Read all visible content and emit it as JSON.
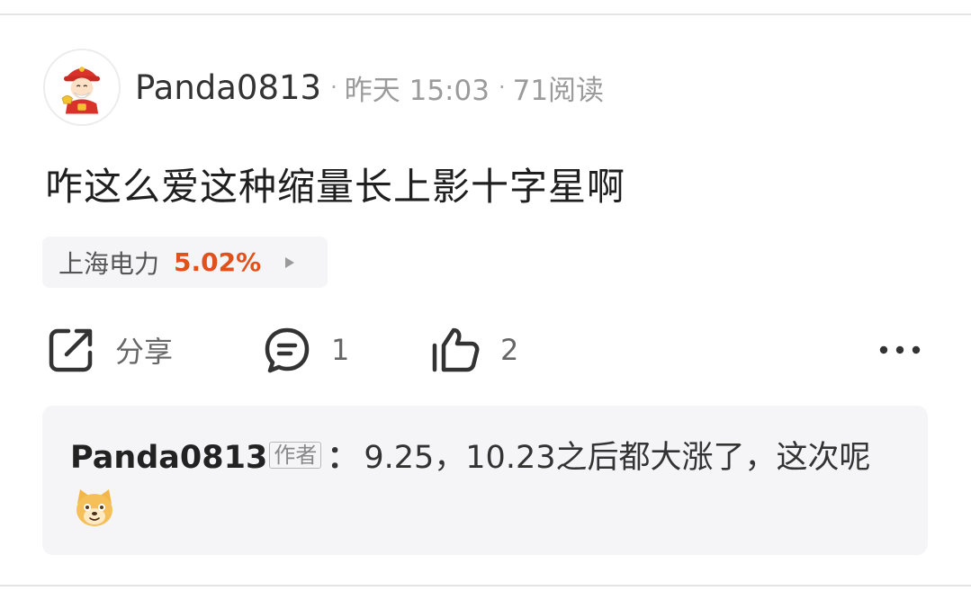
{
  "post": {
    "username": "Panda0813",
    "separator_1": "·",
    "time": "昨天 15:03",
    "separator_2": "·",
    "views": "71阅读",
    "text": "咋这么爱这种缩量长上影十字星啊"
  },
  "stock_tag": {
    "name": "上海电力",
    "change": "5.02%",
    "change_color": "#e2511c"
  },
  "actions": {
    "share_label": "分享",
    "comment_count": "1",
    "like_count": "2",
    "icons": [
      "share-icon",
      "comment-icon",
      "thumbs-up-icon",
      "more-icon"
    ]
  },
  "comment": {
    "author": "Panda0813",
    "badge": "作者",
    "colon": "：",
    "text": "9.25，10.23之后都大涨了，这次呢",
    "emoji": "dog-face-emoji"
  }
}
